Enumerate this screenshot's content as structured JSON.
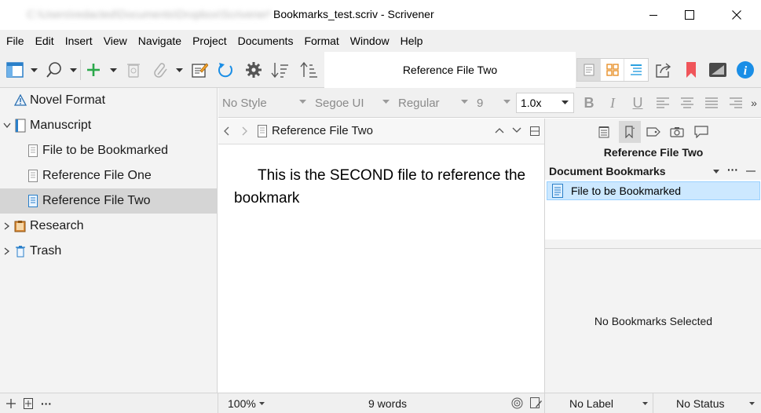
{
  "window": {
    "title_path_blurred": "C:\\Users\\redacted\\Documents\\Dropbox\\Scrivener\\",
    "title": "Bookmarks_test.scriv - Scrivener",
    "controls": [
      "minimize-icon",
      "maximize-icon",
      "close-icon"
    ]
  },
  "menu": {
    "items": [
      "File",
      "Edit",
      "Insert",
      "View",
      "Navigate",
      "Project",
      "Documents",
      "Format",
      "Window",
      "Help"
    ]
  },
  "toolbar": {
    "document_title": "Reference File Two",
    "icons": [
      "binder-toggle-icon",
      "search-icon",
      "add-icon",
      "trash-icon",
      "paperclip-icon",
      "quick-ref-icon",
      "sync-icon",
      "gear-icon",
      "sort-down-icon",
      "sort-up-icon",
      "single-layout-icon",
      "corkboard-layout-icon",
      "outline-layout-icon",
      "share-icon",
      "bookmark-icon",
      "compose-icon",
      "info-icon"
    ],
    "colors": {
      "add": "#2aa84a",
      "bookmark": "#f0555a",
      "info": "#1a8ee6",
      "sync": "#1a8ee6",
      "layout_active": "#dcdcdc"
    }
  },
  "binder": {
    "items": [
      {
        "label": "Novel Format",
        "icon": "warning-icon",
        "level": 0,
        "expander": "none",
        "selected": false
      },
      {
        "label": "Manuscript",
        "icon": "manuscript-icon",
        "level": 0,
        "expander": "expanded",
        "selected": false
      },
      {
        "label": "File to be Bookmarked",
        "icon": "document-icon",
        "level": 1,
        "expander": "none",
        "selected": false
      },
      {
        "label": "Reference File One",
        "icon": "document-icon",
        "level": 1,
        "expander": "none",
        "selected": false
      },
      {
        "label": "Reference File Two",
        "icon": "document-icon",
        "level": 1,
        "expander": "none",
        "selected": true
      },
      {
        "label": "Research",
        "icon": "research-icon",
        "level": 0,
        "expander": "collapsed",
        "selected": false
      },
      {
        "label": "Trash",
        "icon": "trash-icon",
        "level": 0,
        "expander": "collapsed",
        "selected": false
      }
    ]
  },
  "format_bar": {
    "style": "No Style",
    "font": "Segoe UI",
    "weight": "Regular",
    "size": "9",
    "zoom": "1.0x",
    "bold": "B",
    "italic": "I",
    "underline": "U",
    "more": "»"
  },
  "editor": {
    "header_title": "Reference File Two",
    "text": "This is the SECOND file to reference the bookmark",
    "zoom": "100%",
    "word_count": "9 words"
  },
  "inspector": {
    "doc_title": "Reference File Two",
    "bookmarks_heading": "Document Bookmarks",
    "bookmarks": [
      "File to be Bookmarked"
    ],
    "empty_message": "No Bookmarks Selected",
    "label_value": "No Label",
    "status_value": "No Status",
    "more": "···"
  },
  "footer": {
    "more": "···"
  }
}
